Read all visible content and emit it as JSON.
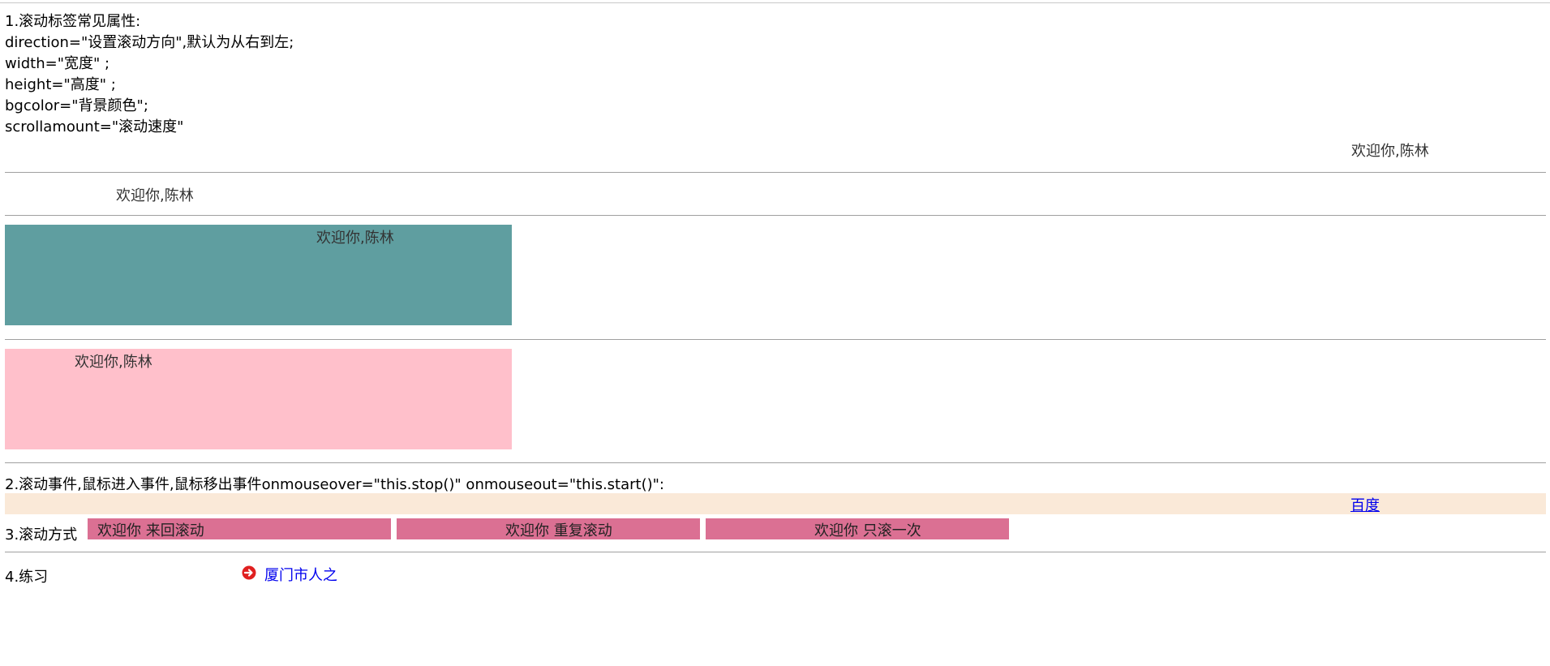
{
  "intro": {
    "lines": [
      "1.滚动标签常见属性:",
      "direction=\"设置滚动方向\",默认为从右到左;",
      "width=\"宽度\" ;",
      "height=\"高度\" ;",
      "bgcolor=\"背景颜色\";",
      "scrollamount=\"滚动速度\""
    ]
  },
  "marquees": {
    "m1": "欢迎你,陈林",
    "m2": "欢迎你,陈林",
    "m3": "欢迎你,陈林",
    "m4": "欢迎你,陈林"
  },
  "colors": {
    "teal_box": "#5f9ea0",
    "pink_box": "#ffc0cb",
    "event_strip": "#fae9d8",
    "mode_box": "#db7093",
    "link": "#0000ee"
  },
  "section2": {
    "text": "2.滚动事件,鼠标进入事件,鼠标移出事件onmouseover=\"this.stop()\" onmouseout=\"this.start()\":",
    "link": "百度"
  },
  "section3": {
    "label": "3.滚动方式",
    "alternate": "欢迎你 来回滚动",
    "scroll": "欢迎你 重复滚动",
    "slide": "欢迎你 只滚一次"
  },
  "section4": {
    "label": "4.练习",
    "link": "厦门市人之",
    "icon": "arrow-circle-right-icon"
  }
}
